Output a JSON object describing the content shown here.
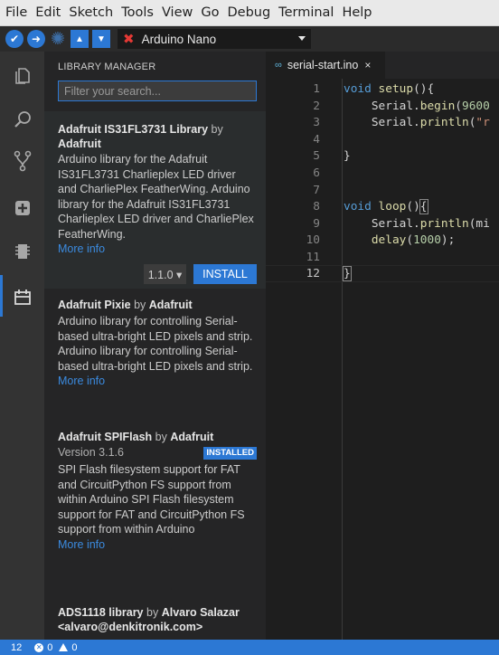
{
  "menu": [
    "File",
    "Edit",
    "Sketch",
    "Tools",
    "View",
    "Go",
    "Debug",
    "Terminal",
    "Help"
  ],
  "toolbar": {
    "board": "Arduino Nano",
    "buttons": [
      "verify-icon",
      "upload-icon",
      "debug-icon",
      "upload-arrow-icon",
      "download-arrow-icon"
    ]
  },
  "activity_bar": [
    "files-icon",
    "search-icon",
    "source-control-icon",
    "boards-manager-icon",
    "chip-icon",
    "library-manager-icon"
  ],
  "library_manager": {
    "title": "LIBRARY MANAGER",
    "filter_placeholder": "Filter your search...",
    "items": [
      {
        "name": "Adafruit IS31FL3731 Library",
        "by_word": "by",
        "author": "Adafruit",
        "description": "Arduino library for the Adafruit IS31FL3731 Charlieplex LED driver and CharliePlex FeatherWing. Arduino library for the Adafruit IS31FL3731 Charlieplex LED driver and CharliePlex FeatherWing.",
        "more": "More info",
        "version": "1.1.0 ▾",
        "install": "INSTALL"
      },
      {
        "name": "Adafruit Pixie",
        "by_word": "by",
        "author": "Adafruit",
        "description": "Arduino library for controlling Serial-based ultra-bright LED pixels and strip. Arduino library for controlling Serial-based ultra-bright LED pixels and strip.",
        "more": "More info"
      },
      {
        "name": "Adafruit SPIFlash",
        "by_word": "by",
        "author": "Adafruit",
        "version": "Version 3.1.6",
        "badge": "INSTALLED",
        "description": "SPI Flash filesystem support for FAT and CircuitPython FS support from within Arduino SPI Flash filesystem support for FAT and CircuitPython FS support from within Arduino",
        "more": "More info"
      },
      {
        "name": "ADS1118 library",
        "by_word": "by",
        "author": "Alvaro Salazar <alvaro@denkitronik.com>"
      }
    ]
  },
  "editor": {
    "tab_label": "serial-start.ino",
    "tab_close": "×",
    "line_numbers": [
      "1",
      "2",
      "3",
      "4",
      "5",
      "6",
      "7",
      "8",
      "9",
      "10",
      "11",
      "12"
    ],
    "current_line": "12",
    "code": {
      "l1_kw": "void",
      "l1_fn": "setup",
      "l1_rest": "(){",
      "l2_obj": "Serial.",
      "l2_fn": "begin",
      "l2_open": "(",
      "l2_num": "9600",
      "l3_obj": "Serial.",
      "l3_fn": "println",
      "l3_open": "(",
      "l3_str": "\"r",
      "l5": "}",
      "l8_kw": "void",
      "l8_fn": "loop",
      "l8_rest": "()",
      "l8_brace": "{",
      "l9_obj": "Serial.",
      "l9_fn": "println",
      "l9_rest": "(mi",
      "l10_fn": "delay",
      "l10_open": "(",
      "l10_num": "1000",
      "l10_close": ");",
      "l12": "}"
    }
  },
  "status": {
    "line": "12",
    "errors": "0",
    "warnings": "0"
  },
  "colors": {
    "accent": "#2c78d4",
    "error_x": "#e53935"
  }
}
